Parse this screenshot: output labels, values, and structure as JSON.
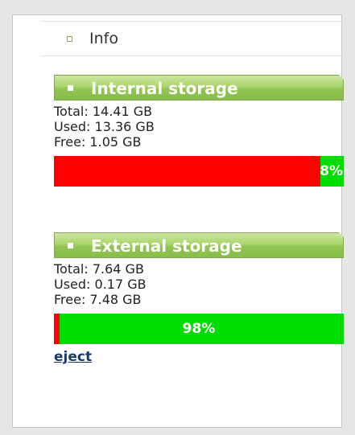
{
  "info": {
    "label": "Info"
  },
  "internal_storage": {
    "title": "Internal storage",
    "total": "Total: 14.41 GB",
    "used": "Used: 13.36 GB",
    "free": "Free: 1.05 GB",
    "free_percent_label": "8%",
    "used_fraction": 0.92
  },
  "external_storage": {
    "title": "External storage",
    "total": "Total: 7.64 GB",
    "used": "Used: 0.17 GB",
    "free": "Free: 7.48 GB",
    "free_percent_label": "98%",
    "used_fraction": 0.02,
    "eject_label": "eject"
  },
  "colors": {
    "used": "#ff0000",
    "free": "#00dd00",
    "header_green": "#92c553",
    "link": "#1a3a6e"
  },
  "icons": {
    "info_bullet": "square-outline-icon",
    "header_bullet": "square-filled-icon"
  }
}
